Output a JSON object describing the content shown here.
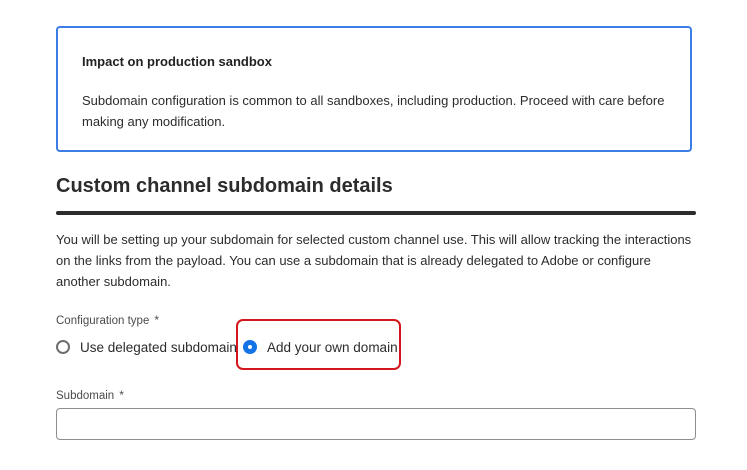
{
  "notice": {
    "title": "Impact on production sandbox",
    "body": "Subdomain configuration is common to all sandboxes, including production. Proceed with care before making any modification."
  },
  "section": {
    "title": "Custom channel subdomain details",
    "description": "You will be setting up your subdomain for selected custom channel use. This will allow tracking the interactions on the links from the payload. You can use a subdomain that is already delegated to Adobe or configure another subdomain."
  },
  "configuration_type": {
    "label": "Configuration type",
    "required_mark": "*",
    "options": [
      {
        "label": "Use delegated subdomain",
        "selected": false
      },
      {
        "label": "Add your own domain",
        "selected": true
      }
    ]
  },
  "subdomain": {
    "label": "Subdomain",
    "required_mark": "*",
    "value": ""
  },
  "colors": {
    "notice_border": "#3b7de4",
    "radio_selected": "#1473e6",
    "highlight_border": "#d4171d"
  }
}
